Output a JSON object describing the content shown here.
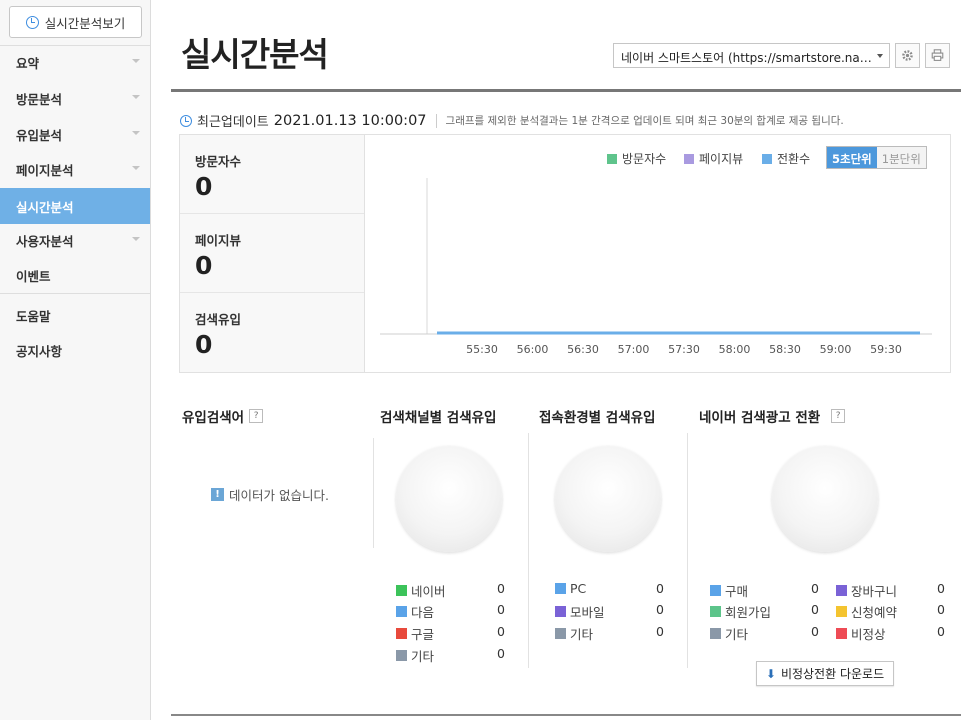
{
  "sidebar": {
    "realtime_button": "실시간분석보기",
    "items": [
      {
        "label": "요약",
        "has_chevron": true,
        "active": false
      },
      {
        "label": "방문분석",
        "has_chevron": true,
        "active": false
      },
      {
        "label": "유입분석",
        "has_chevron": true,
        "active": false
      },
      {
        "label": "페이지분석",
        "has_chevron": true,
        "active": false
      },
      {
        "label": "실시간분석",
        "has_chevron": false,
        "active": true
      },
      {
        "label": "사용자분석",
        "has_chevron": true,
        "active": false
      },
      {
        "label": "이벤트",
        "has_chevron": false,
        "active": false
      }
    ],
    "bottom_items": [
      {
        "label": "도움말"
      },
      {
        "label": "공지사항"
      }
    ]
  },
  "header": {
    "title": "실시간분석",
    "store_select": "네이버 스마트스토어 (https://smartstore.na…",
    "icons": [
      "gear-icon",
      "print-icon"
    ]
  },
  "update": {
    "label": "최근업데이트",
    "datetime": "2021.01.13 10:00:07",
    "note": "그래프를 제외한 분석결과는 1분 간격으로 업데이트 되며 최근 30분의 합계로 제공 됩니다."
  },
  "stats": [
    {
      "label": "방문자수",
      "value": "0"
    },
    {
      "label": "페이지뷰",
      "value": "0"
    },
    {
      "label": "검색유입",
      "value": "0"
    }
  ],
  "chart_legend": [
    {
      "label": "방문자수",
      "color": "#5fc48c"
    },
    {
      "label": "페이지뷰",
      "color": "#a99ae0"
    },
    {
      "label": "전환수",
      "color": "#6aaee8"
    }
  ],
  "unit_toggle": {
    "active": "5초단위",
    "inactive": "1분단위"
  },
  "chart_data": {
    "type": "line",
    "x": [
      "55:30",
      "56:00",
      "56:30",
      "57:00",
      "57:30",
      "58:00",
      "58:30",
      "59:00",
      "59:30"
    ],
    "series": [
      {
        "name": "방문자수",
        "values": [
          0,
          0,
          0,
          0,
          0,
          0,
          0,
          0,
          0
        ]
      },
      {
        "name": "페이지뷰",
        "values": [
          0,
          0,
          0,
          0,
          0,
          0,
          0,
          0,
          0
        ]
      },
      {
        "name": "전환수",
        "values": [
          0,
          0,
          0,
          0,
          0,
          0,
          0,
          0,
          0
        ]
      }
    ],
    "title": "",
    "xlabel": "",
    "ylabel": "",
    "grid": false
  },
  "sections": {
    "keyword": {
      "title": "유입검색어",
      "help": "?",
      "nodata_icon": "!",
      "nodata": "데이터가 없습니다."
    },
    "channel": {
      "title": "검색채널별 검색유입",
      "items": [
        {
          "label": "네이버",
          "value": "0",
          "color": "#3cc35a"
        },
        {
          "label": "다음",
          "value": "0",
          "color": "#5aa3e8"
        },
        {
          "label": "구글",
          "value": "0",
          "color": "#e84a3c"
        },
        {
          "label": "기타",
          "value": "0",
          "color": "#8a98a8"
        }
      ]
    },
    "env": {
      "title": "접속환경별 검색유입",
      "items": [
        {
          "label": "PC",
          "value": "0",
          "color": "#5aa3e8"
        },
        {
          "label": "모바일",
          "value": "0",
          "color": "#7a62d6"
        },
        {
          "label": "기타",
          "value": "0",
          "color": "#8a98a8"
        }
      ]
    },
    "ads": {
      "title": "네이버 검색광고 전환",
      "help": "?",
      "items_left": [
        {
          "label": "구매",
          "value": "0",
          "color": "#5aa3e8"
        },
        {
          "label": "회원가입",
          "value": "0",
          "color": "#5cc48a"
        },
        {
          "label": "기타",
          "value": "0",
          "color": "#8a98a8"
        }
      ],
      "items_right": [
        {
          "label": "장바구니",
          "value": "0",
          "color": "#7a62d6"
        },
        {
          "label": "신청예약",
          "value": "0",
          "color": "#f4c430"
        },
        {
          "label": "비정상",
          "value": "0",
          "color": "#ee4b55"
        }
      ],
      "download_button": "비정상전환 다운로드"
    }
  }
}
